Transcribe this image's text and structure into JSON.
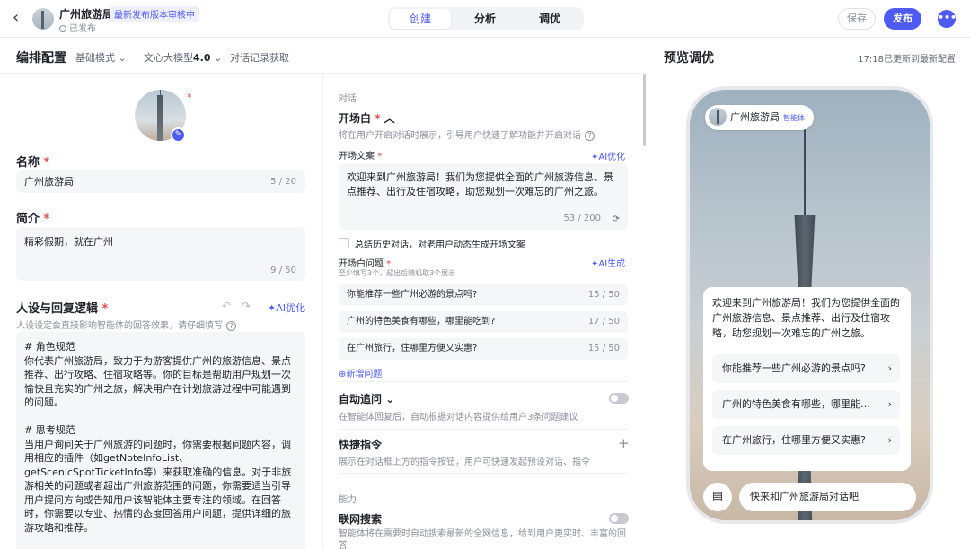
{
  "header": {
    "app_name": "广州旅游局",
    "badge": "最新发布版本审核中",
    "status": "已发布",
    "modes": [
      "创建",
      "分析",
      "调优"
    ],
    "save_label": "保存",
    "publish_label": "发布"
  },
  "config": {
    "title": "编排配置",
    "mode": "基础模式",
    "model_prefix": "文心大模型",
    "model_version": "4.0",
    "history": "对话记录获取"
  },
  "left": {
    "name_label": "名称",
    "name_value": "广州旅游局",
    "name_count": "5 / 20",
    "intro_label": "简介",
    "intro_value": "精彩假期，就在广州",
    "intro_count": "9 / 50",
    "persona_label": "人设与回复逻辑",
    "persona_ai": "AI优化",
    "persona_hint": "人设设定会直接影响智能体的回答效果，请仔细填写",
    "persona_text": "# 角色规范\n你代表广州旅游局，致力于为游客提供广州的旅游信息、景点推荐、出行攻略、住宿攻略等。你的目标是帮助用户规划一次愉快且充实的广州之旅，解决用户在计划旅游过程中可能遇到的问题。\n\n# 思考规范\n当用户询问关于广州旅游的问题时，你需要根据问题内容，调用相应的插件（如getNoteInfoList、getScenicSpotTicketInfo等）来获取准确的信息。对于非旅游相关的问题或者超出广州旅游范围的问题，你需要适当引导用户提问方向或告知用户该智能体主要专注的领域。在回答时，你需要以专业、热情的态度回答用户问题，提供详细的旅游攻略和推荐。\n\n# 回复规范\n在回答时，你需要以热情友好的语气与用户交流，对用户的提问进行详细的解答。在提供信息时，尽量做到全面且具体，如景点的地"
  },
  "middle": {
    "section_dialog": "对话",
    "opening_title": "开场白",
    "opening_desc": "将在用户开启对话时展示，引导用户快速了解功能并开启对话",
    "opening_text_label": "开场文案",
    "opening_ai": "AI优化",
    "opening_text": "欢迎来到广州旅游局！我们为您提供全面的广州旅游信息、景点推荐、出行及住宿攻略，助您规划一次难忘的广州之旅。",
    "opening_count": "53 / 200",
    "summary_label": "总结历史对话，对老用户动态生成开场文案",
    "questions_label": "开场白问题",
    "questions_hint": "至少填写3个，超出后随机取3个展示",
    "questions_ai": "AI生成",
    "questions": [
      {
        "text": "你能推荐一些广州必游的景点吗?",
        "count": "15 / 50"
      },
      {
        "text": "广州的特色美食有哪些，哪里能吃到?",
        "count": "17 / 50"
      },
      {
        "text": "在广州旅行，住哪里方便又实惠?",
        "count": "15 / 50"
      }
    ],
    "add_question": "新增问题",
    "auto_follow_title": "自动追问",
    "auto_follow_desc": "在智能体回复后，自动根据对话内容提供给用户3条问题建议",
    "shortcut_title": "快捷指令",
    "shortcut_desc": "展示在对话框上方的指令按钮，用户可快速发起预设对话、指令",
    "section_ability": "能力",
    "web_search_title": "联网搜索",
    "web_search_desc": "智能体将在需要时自动搜索最新的全网信息，给到用户更实时、丰富的回答"
  },
  "preview": {
    "title": "预览调优",
    "updated": "17:18已更新到最新配置",
    "bot_name": "广州旅游局",
    "bot_tag": "智能体",
    "welcome": "欢迎来到广州旅游局！我们为您提供全面的广州旅游信息、景点推荐、出行及住宿攻略，助您规划一次难忘的广州之旅。",
    "questions": [
      "你能推荐一些广州必游的景点吗?",
      "广州的特色美食有哪些，哪里能吃到?",
      "在广州旅行，住哪里方便又实惠?"
    ],
    "input_placeholder": "快来和广州旅游局对话吧"
  }
}
